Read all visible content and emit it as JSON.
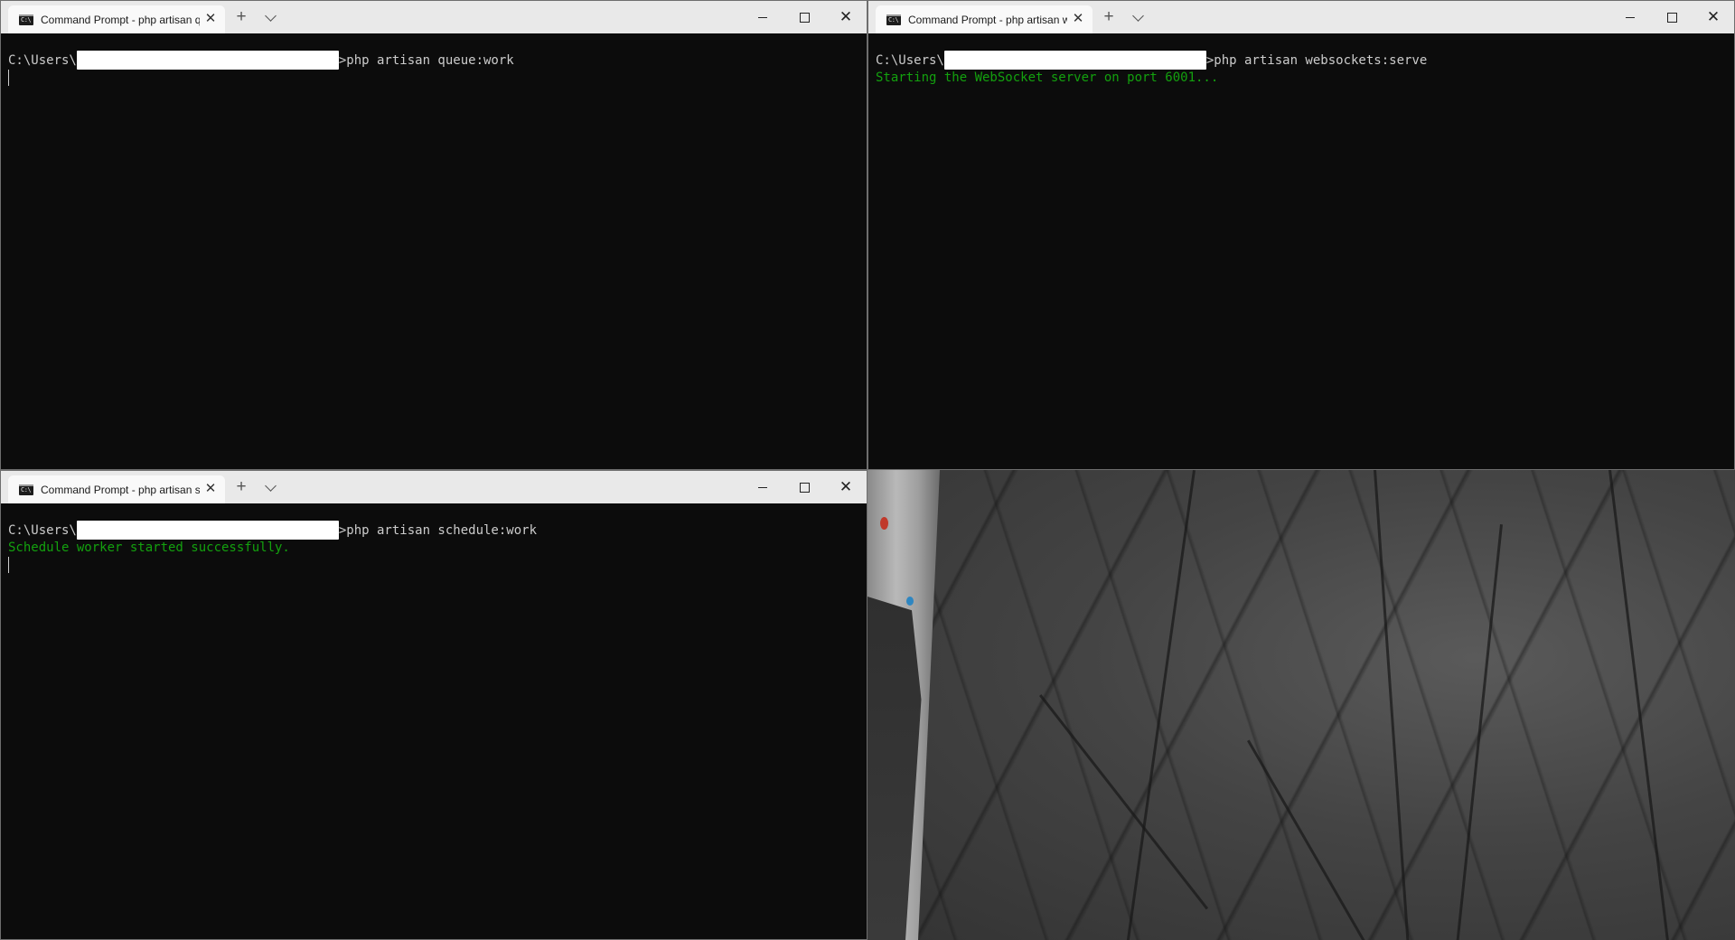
{
  "windows": [
    {
      "id": "top-left",
      "tab_title": "Command Prompt - php  artisan queue:work",
      "prompt_prefix": "C:\\Users\\",
      "command": ">php artisan queue:work",
      "output": []
    },
    {
      "id": "top-right",
      "tab_title": "Command Prompt - php  artisan websockets:serve",
      "prompt_prefix": "C:\\Users\\",
      "command": ">php artisan websockets:serve",
      "output": [
        "Starting the WebSocket server on port 6001..."
      ]
    },
    {
      "id": "bottom-left",
      "tab_title": "Command Prompt - php  artisan schedule:work",
      "prompt_prefix": "C:\\Users\\",
      "command": ">php artisan schedule:work",
      "output": [
        "Schedule worker started successfully."
      ]
    }
  ],
  "icons": {
    "tab_icon": "cmd-icon",
    "close_tab": "close-icon",
    "new_tab": "plus-icon",
    "dropdown": "chevron-down-icon",
    "minimize": "minimize-icon",
    "maximize": "maximize-icon",
    "close_window": "close-icon"
  },
  "glyphs": {
    "close": "✕",
    "plus": "+"
  },
  "colors": {
    "console_bg": "#0c0c0c",
    "console_text": "#cccccc",
    "success_text": "#13a10e",
    "titlebar_bg": "#e9e9e9",
    "tab_bg": "#f9f9f9"
  }
}
